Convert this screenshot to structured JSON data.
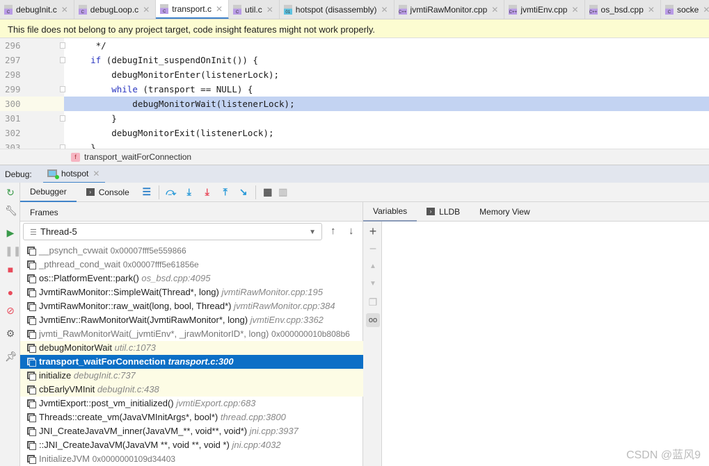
{
  "tabs": [
    {
      "label": "debugInit.c",
      "icon": "c-file-icon",
      "ext": "C"
    },
    {
      "label": "debugLoop.c",
      "icon": "c-file-icon",
      "ext": "C"
    },
    {
      "label": "transport.c",
      "icon": "c-file-icon",
      "ext": "C",
      "active": true
    },
    {
      "label": "util.c",
      "icon": "c-file-icon",
      "ext": "C"
    },
    {
      "label": "hotspot (disassembly)",
      "icon": "disassembly-icon",
      "ext": "01"
    },
    {
      "label": "jvmtiRawMonitor.cpp",
      "icon": "cpp-file-icon",
      "ext": "C++"
    },
    {
      "label": "jvmtiEnv.cpp",
      "icon": "cpp-file-icon",
      "ext": "C++"
    },
    {
      "label": "os_bsd.cpp",
      "icon": "cpp-file-icon",
      "ext": "C++"
    },
    {
      "label": "socke",
      "icon": "c-file-icon",
      "ext": "C"
    }
  ],
  "banner": "This file does not belong to any project target, code insight features might not work properly.",
  "code": {
    "lines": [
      {
        "n": "296",
        "pre": "     */",
        "kw": "",
        "post": ""
      },
      {
        "n": "297",
        "pre": "    ",
        "kw": "if",
        "post": " (debugInit_suspendOnInit()) {"
      },
      {
        "n": "298",
        "pre": "        debugMonitorEnter(listenerLock);",
        "kw": "",
        "post": ""
      },
      {
        "n": "299",
        "pre": "        ",
        "kw": "while",
        "post": " (transport == NULL) {"
      },
      {
        "n": "300",
        "pre": "            debugMonitorWait(listenerLock);",
        "kw": "",
        "post": "",
        "highlight": true
      },
      {
        "n": "301",
        "pre": "        }",
        "kw": "",
        "post": ""
      },
      {
        "n": "302",
        "pre": "        debugMonitorExit(listenerLock);",
        "kw": "",
        "post": ""
      },
      {
        "n": "303",
        "pre": "    }",
        "kw": "",
        "post": ""
      }
    ]
  },
  "breadcrumb": {
    "badge": "f",
    "label": "transport_waitForConnection"
  },
  "debug": {
    "label": "Debug:",
    "session": "hotspot"
  },
  "toolbar": {
    "debugger": "Debugger",
    "console": "Console"
  },
  "frames": {
    "header": "Frames",
    "thread": "Thread-5",
    "items": [
      {
        "name": "__psynch_cvwait",
        "loc": "",
        "addr": "0x00007fff5e559866",
        "style": "dim"
      },
      {
        "name": "_pthread_cond_wait",
        "loc": "",
        "addr": "0x00007fff5e61856e",
        "style": "dim"
      },
      {
        "name": "os::PlatformEvent::park()",
        "loc": "os_bsd.cpp:4095",
        "addr": "",
        "style": ""
      },
      {
        "name": "JvmtiRawMonitor::SimpleWait(Thread*, long)",
        "loc": "jvmtiRawMonitor.cpp:195",
        "addr": "",
        "style": ""
      },
      {
        "name": "JvmtiRawMonitor::raw_wait(long, bool, Thread*)",
        "loc": "jvmtiRawMonitor.cpp:384",
        "addr": "",
        "style": ""
      },
      {
        "name": "JvmtiEnv::RawMonitorWait(JvmtiRawMonitor*, long)",
        "loc": "jvmtiEnv.cpp:3362",
        "addr": "",
        "style": ""
      },
      {
        "name": "jvmti_RawMonitorWait(_jvmtiEnv*, _jrawMonitorID*, long)",
        "loc": "",
        "addr": "0x000000010b808b6",
        "style": "dim"
      },
      {
        "name": "debugMonitorWait",
        "loc": "util.c:1073",
        "addr": "",
        "style": "yellow"
      },
      {
        "name": "transport_waitForConnection",
        "loc": "transport.c:300",
        "addr": "",
        "style": "sel"
      },
      {
        "name": "initialize",
        "loc": "debugInit.c:737",
        "addr": "",
        "style": "yellow"
      },
      {
        "name": "cbEarlyVMInit",
        "loc": "debugInit.c:438",
        "addr": "",
        "style": "yellow"
      },
      {
        "name": "JvmtiExport::post_vm_initialized()",
        "loc": "jvmtiExport.cpp:683",
        "addr": "",
        "style": ""
      },
      {
        "name": "Threads::create_vm(JavaVMInitArgs*, bool*)",
        "loc": "thread.cpp:3800",
        "addr": "",
        "style": ""
      },
      {
        "name": "JNI_CreateJavaVM_inner(JavaVM_**, void**, void*)",
        "loc": "jni.cpp:3937",
        "addr": "",
        "style": ""
      },
      {
        "name": "::JNI_CreateJavaVM(JavaVM **, void **, void *)",
        "loc": "jni.cpp:4032",
        "addr": "",
        "style": ""
      },
      {
        "name": "InitializeJVM",
        "loc": "",
        "addr": "0x0000000109d34403",
        "style": "dim"
      }
    ]
  },
  "variables": {
    "tabs": [
      "Variables",
      "LLDB",
      "Memory View"
    ]
  },
  "watermark": "CSDN @蓝风9",
  "colors": {
    "accent": "#4083c9",
    "selection": "#0c6fc6",
    "execLine": "#c3d3f2",
    "banner": "#fcfcd1"
  }
}
